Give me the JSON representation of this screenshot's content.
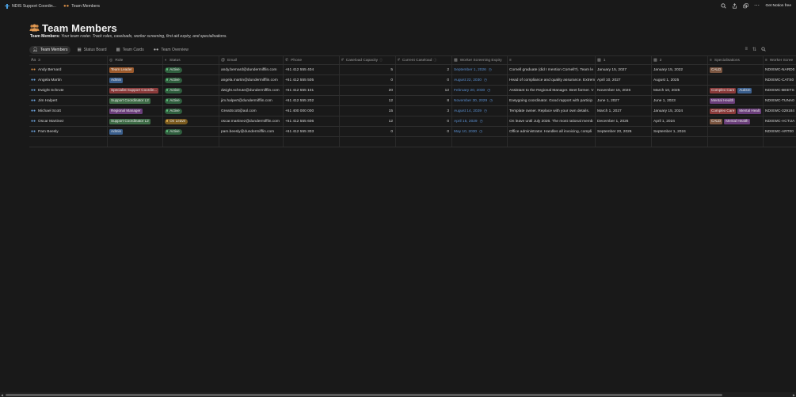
{
  "topbar": {
    "breadcrumb_1": "NDIS Support Coordin...",
    "breadcrumb_2": "Team Members",
    "get_free": "Get Notion free"
  },
  "header": {
    "title": "Team Members",
    "subtitle_bold": "Team Members:",
    "subtitle_text": "Your team roster. Track roles, caseloads, worker screening, first aid expiry, and specialisations."
  },
  "tabs": [
    {
      "label": "Team Members",
      "active": true
    },
    {
      "label": "Status Board",
      "active": false
    },
    {
      "label": "Team Cards",
      "active": false
    },
    {
      "label": "Team Overview",
      "active": false
    }
  ],
  "columns": {
    "name": "3",
    "role": "Role",
    "status": "Status",
    "email": "Email",
    "phone": "Phone",
    "capacity": "Caseload Capacity",
    "current": "Current Caseload",
    "expiry": "Worker Screening Expiry",
    "notes": "",
    "d1": "1",
    "d2": "2",
    "spec": "Specialisations",
    "ws": "Worker Scree"
  },
  "colors": {
    "role_team_leader": "#9c5a2c",
    "role_admin": "#3a5e8c",
    "role_specialist": "#8a3a3a",
    "role_support": "#3e6b46",
    "role_regional": "#6a3e7a",
    "status_active": "#2f5e3e",
    "status_onleave": "#7a5a1e",
    "spec_cald": "#7a5540",
    "spec_complex": "#8a3a3a",
    "spec_autism": "#3a5e8c",
    "spec_mental": "#6a3e7a"
  },
  "rows": [
    {
      "name": "Andy Bernard",
      "lead": true,
      "role": "Team Leader",
      "role_color": "#9c5a2c",
      "status": "Active",
      "status_color": "#2f5e3e",
      "dot": "#5fbf7a",
      "email": "andy.bernard@dundermifflin.com",
      "phone": "+61 412 555 404",
      "capacity": "5",
      "current": "2",
      "expiry": "September 1, 2026",
      "notes": "Cornell graduate (did I mention Cornell?). Team le",
      "d1": "January 15, 2027",
      "d2": "January 15, 2022",
      "specs": [
        {
          "label": "CALD",
          "color": "#7a5540"
        }
      ],
      "ws": "NDISWC-NARD0"
    },
    {
      "name": "Angela Martin",
      "lead": false,
      "role": "Admin",
      "role_color": "#3a5e8c",
      "status": "Active",
      "status_color": "#2f5e3e",
      "dot": "#5fbf7a",
      "email": "angela.martin@dundermifflin.com",
      "phone": "+61 412 555 505",
      "capacity": "0",
      "current": "0",
      "expiry": "August 22, 2030",
      "notes": "Head of compliance and quality assurance. Extrem",
      "d1": "April 10, 2027",
      "d2": "August 1, 2025",
      "specs": [],
      "ws": "NDISWC-CATS0"
    },
    {
      "name": "Dwight Schrute",
      "lead": false,
      "role": "Specialist Support Coordin...",
      "role_color": "#8a3a3a",
      "status": "Active",
      "status_color": "#2f5e3e",
      "dot": "#5fbf7a",
      "email": "dwight.schrute@dundermifflin.com",
      "phone": "+61 412 555 101",
      "capacity": "20",
      "current": "12",
      "expiry": "February 20, 2030",
      "notes": "Assistant to the Regional Manager. Beet farmer. V",
      "d1": "November 15, 2026",
      "d2": "March 10, 2025",
      "specs": [
        {
          "label": "Complex Care",
          "color": "#8a3a3a"
        },
        {
          "label": "Autism",
          "color": "#3a5e8c"
        }
      ],
      "ws": "NDISWC-BEETS"
    },
    {
      "name": "Jim Halpert",
      "lead": false,
      "role": "Support Coordinator L2",
      "role_color": "#3e6b46",
      "status": "Active",
      "status_color": "#2f5e3e",
      "dot": "#5fbf7a",
      "email": "jim.halpert@dundermifflin.com",
      "phone": "+61 412 555 202",
      "capacity": "12",
      "current": "8",
      "expiry": "November 30, 2029",
      "notes": "Easygoing coordinator. Good rapport with particip",
      "d1": "June 1, 2027",
      "d2": "June 1, 2023",
      "specs": [
        {
          "label": "Mental Health",
          "color": "#6a3e7a"
        }
      ],
      "ws": "NDISWC-TUNA0"
    },
    {
      "name": "Michael Scott",
      "lead": false,
      "role": "Regional Manager",
      "role_color": "#6a3e7a",
      "status": "Active",
      "status_color": "#2f5e3e",
      "dot": "#5fbf7a",
      "email": "GreatScott@aol.com",
      "phone": "+61 400 000 000",
      "capacity": "15",
      "current": "3",
      "expiry": "August 14, 2029",
      "notes": "Template owner. Replace with your own details.",
      "d1": "March 1, 2027",
      "d2": "January 15, 2024",
      "specs": [
        {
          "label": "Complex Care",
          "color": "#8a3a3a"
        },
        {
          "label": "Mental Healt",
          "color": "#6a3e7a"
        }
      ],
      "ws": "NDISWC-329184"
    },
    {
      "name": "Oscar Martinez",
      "lead": false,
      "role": "Support Coordinator L2",
      "role_color": "#3e6b46",
      "status": "On Leave",
      "status_color": "#7a5a1e",
      "dot": "#e0b050",
      "email": "oscar.martinez@dundermifflin.com",
      "phone": "+61 412 555 606",
      "capacity": "12",
      "current": "0",
      "expiry": "April 15, 2029",
      "notes": "On leave until July 2026. The most rational memb",
      "d1": "December 1, 2026",
      "d2": "April 1, 2024",
      "specs": [
        {
          "label": "CALD",
          "color": "#7a5540"
        },
        {
          "label": "Mental Health",
          "color": "#6a3e7a"
        }
      ],
      "ws": "NDISWC-ACTUA"
    },
    {
      "name": "Pam Beesly",
      "lead": false,
      "role": "Admin",
      "role_color": "#3a5e8c",
      "status": "Active",
      "status_color": "#2f5e3e",
      "dot": "#5fbf7a",
      "email": "pam.beesly@dundermifflin.com",
      "phone": "+61 412 555 303",
      "capacity": "0",
      "current": "0",
      "expiry": "May 10, 2030",
      "notes": "Office administrator. Handles all invoicing, compli",
      "d1": "September 20, 2026",
      "d2": "September 1, 2024",
      "specs": [],
      "ws": "NDISWC-ART00"
    }
  ]
}
